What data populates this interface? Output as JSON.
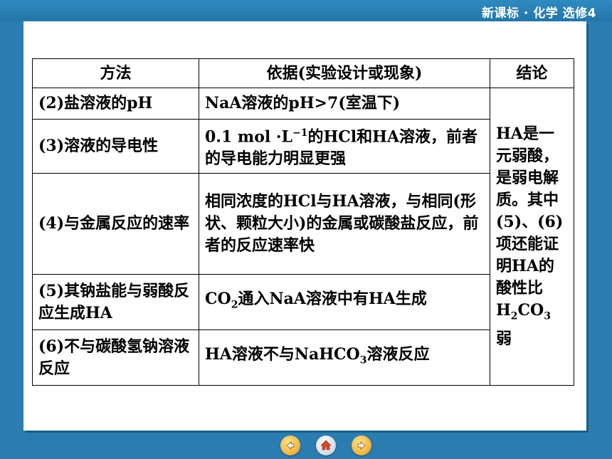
{
  "header": {
    "course": "新课标 · 化学  选修4"
  },
  "table": {
    "headers": [
      "方法",
      "依据(实验设计或现象)",
      "结论"
    ],
    "rows": [
      {
        "method": "(2)盐溶液的pH",
        "basis": "NaA溶液的pH>7(室温下)"
      },
      {
        "method": "(3)溶液的导电性",
        "basis_pre": "0.1 mol ·L",
        "basis_sup": "−1",
        "basis_post": "的HCl和HA溶液，前者的导电能力明显更强"
      },
      {
        "method": "(4)与金属反应的速率",
        "basis": "相同浓度的HCl与HA溶液，与相同(形状、颗粒大小)的金属或碳酸盐反应，前者的反应速率快"
      },
      {
        "method": "(5)其钠盐能与弱酸反应生成HA",
        "basis_pre": "CO",
        "basis_sub": "2",
        "basis_post": "通入NaA溶液中有HA生成"
      },
      {
        "method": "(6)不与碳酸氢钠溶液反应",
        "basis_pre": "HA溶液不与NaHCO",
        "basis_sub": "3",
        "basis_post": "溶液反应"
      }
    ],
    "conclusion": {
      "line1": "HA是一元弱酸，是弱电解质。其中(5)、(6)项还能证明HA的酸性比",
      "formula_pre": "H",
      "formula_sub1": "2",
      "formula_mid": "CO",
      "formula_sub2": "3",
      "line_end": "弱"
    }
  },
  "nav": {
    "prev_icon": "previous-icon",
    "home_icon": "home-icon",
    "next_icon": "next-icon"
  },
  "colors": {
    "background": "#2a7db0",
    "slide": "#ffffff",
    "nav_orange": "#e89a1f"
  }
}
